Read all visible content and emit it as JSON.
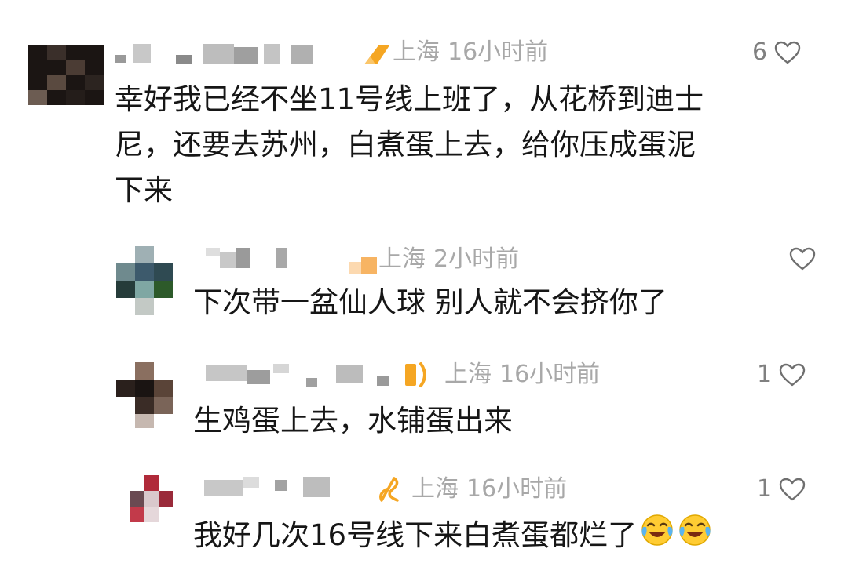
{
  "comments": [
    {
      "location": "上海",
      "time": "16小时前",
      "lines": [
        "幸好我已经不坐11号线上班了，从花桥到迪士",
        "尼，还要去苏州，白煮蛋上去，给你压成蛋泥",
        "下来"
      ],
      "likes": "6"
    },
    {
      "location": "上海",
      "time": "2小时前",
      "lines": [
        "下次带一盆仙人球 别人就不会挤你了"
      ],
      "likes": ""
    },
    {
      "location": "上海",
      "time": "16小时前",
      "lines": [
        "生鸡蛋上去，水铺蛋出来"
      ],
      "likes": "1"
    },
    {
      "location": "上海",
      "time": "16小时前",
      "lines": [
        "我好几次16号线下来白煮蛋都烂了"
      ],
      "likes": "1",
      "emojis": [
        "laughing-crying-icon",
        "laughing-crying-icon"
      ]
    }
  ],
  "colors": {
    "meta": "#a8a8a8",
    "text": "#161616",
    "heart": "#6f6f6f",
    "badge_orange": "#f5a623"
  }
}
